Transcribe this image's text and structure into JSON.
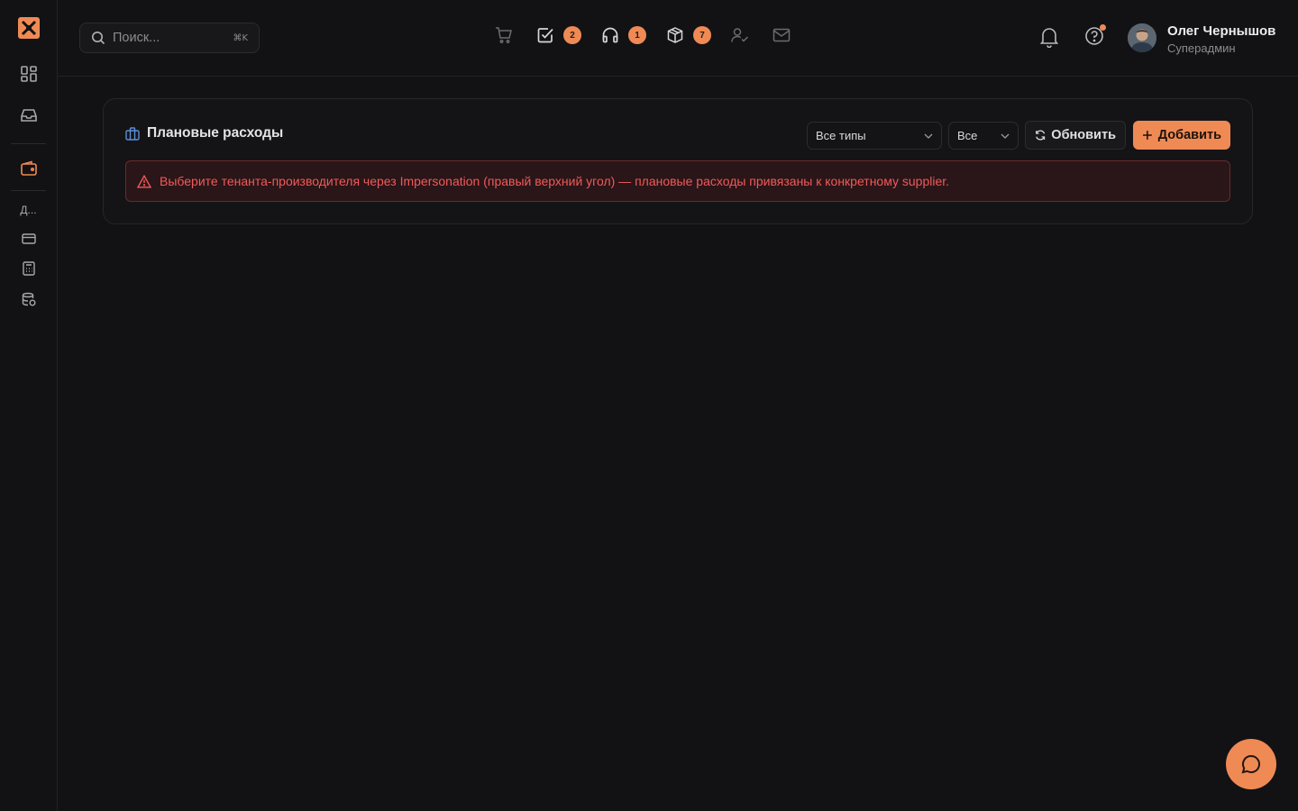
{
  "sidebar": {
    "logo": "brand-logo",
    "items": [
      {
        "name": "dashboard-icon"
      },
      {
        "name": "inbox-icon"
      },
      {
        "name": "wallet-icon"
      },
      {
        "label": "Д..."
      },
      {
        "name": "card-icon"
      },
      {
        "name": "calculator-icon"
      },
      {
        "name": "database-icon"
      }
    ]
  },
  "header": {
    "search": {
      "placeholder": "Поиск...",
      "shortcut": "⌘K"
    },
    "quick_actions": [
      {
        "icon": "cart-icon",
        "badge": ""
      },
      {
        "icon": "checkbox-icon",
        "badge": "2"
      },
      {
        "icon": "headphones-icon",
        "badge": "1"
      },
      {
        "icon": "package-icon",
        "badge": "7"
      },
      {
        "icon": "user-check-icon",
        "badge": ""
      },
      {
        "icon": "mail-icon",
        "badge": ""
      }
    ],
    "user": {
      "name": "Олег Чернышов",
      "role": "Суперадмин"
    }
  },
  "main": {
    "card": {
      "title": "Плановые расходы",
      "type_filter": "Все типы",
      "status_filter": "Все",
      "refresh_label": "Обновить",
      "add_label": "Добавить",
      "alert_text": "Выберите тенанта-производителя через Impersonation (правый верхний угол) — плановые расходы привязаны к конкретному supplier."
    }
  },
  "colors": {
    "accent": "#ef8a55",
    "background": "#121214",
    "error": "#f05a5a",
    "info_icon": "#5d8fd6"
  }
}
